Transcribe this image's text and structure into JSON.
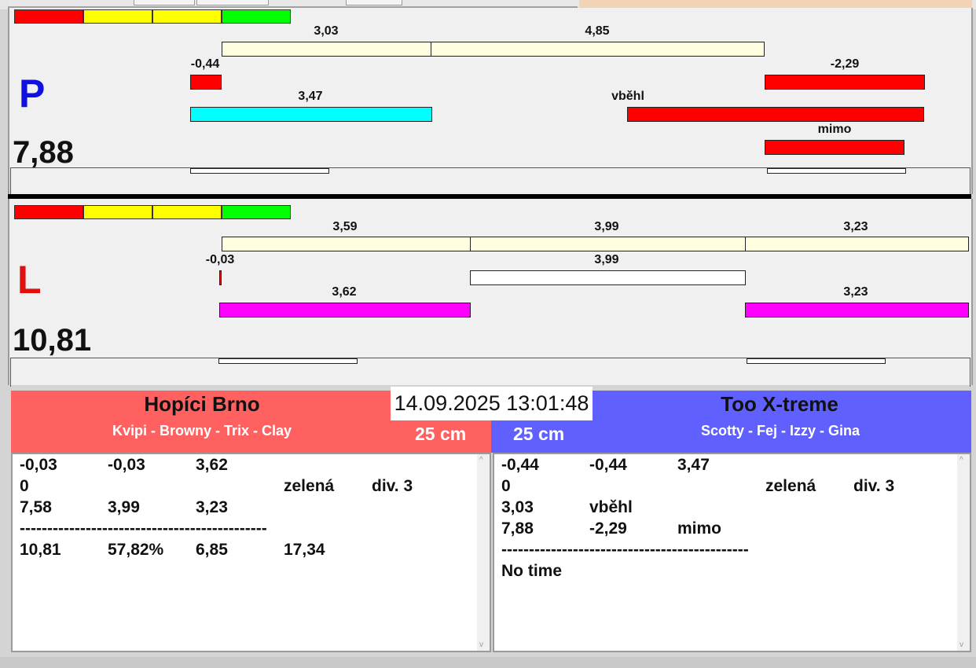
{
  "lanes": {
    "p": {
      "letter": "P",
      "letter_color": "#1010e0",
      "total": "7,88",
      "split_labels": [
        "3,03",
        "4,85"
      ],
      "reaction_label": "-0,44",
      "run_label": "3,47",
      "right_labels": [
        "-2,29",
        "vběhl",
        "mimo"
      ]
    },
    "l": {
      "letter": "L",
      "letter_color": "#e01010",
      "total": "10,81",
      "split_labels": [
        "3,59",
        "3,99",
        "3,23"
      ],
      "reaction_label": "-0,03",
      "mid_label": "3,99",
      "run_labels": [
        "3,62",
        "3,23"
      ]
    }
  },
  "colors": {
    "red": "#ff0000",
    "yellow": "#ffff00",
    "green": "#00ff00",
    "cream": "#ffffdf",
    "cyan": "#00ffff",
    "magenta": "#ff00ff",
    "left_team_bg": "#ff6060",
    "right_team_bg": "#6060ff"
  },
  "datetime": "14.09.2025 13:01:48",
  "left_team": {
    "name": "Hopíci Brno",
    "dogs": "Kvipi - Browny - Trix - Clay",
    "height": "25 cm",
    "rows": [
      [
        "-0,03",
        "-0,03",
        "3,62",
        "",
        ""
      ],
      [
        "0",
        "",
        "",
        "zelená",
        "div. 3"
      ],
      [
        "7,58",
        "3,99",
        "3,23",
        "",
        ""
      ],
      [
        "---------------------------------------------",
        "",
        "",
        "",
        ""
      ],
      [
        "10,81",
        "57,82%",
        "6,85",
        "17,34",
        ""
      ]
    ]
  },
  "right_team": {
    "name": "Too X-treme",
    "dogs": "Scotty - Fej - Izzy - Gina",
    "height": "25 cm",
    "rows": [
      [
        "-0,44",
        "-0,44",
        "3,47",
        "",
        ""
      ],
      [
        "0",
        "",
        "",
        "zelená",
        "div. 3"
      ],
      [
        "3,03",
        "vběhl",
        "",
        "",
        ""
      ],
      [
        "7,88",
        "-2,29",
        "mimo",
        "",
        ""
      ],
      [
        "---------------------------------------------",
        "",
        "",
        "",
        ""
      ],
      [
        "No time",
        "",
        "",
        "",
        ""
      ]
    ]
  }
}
